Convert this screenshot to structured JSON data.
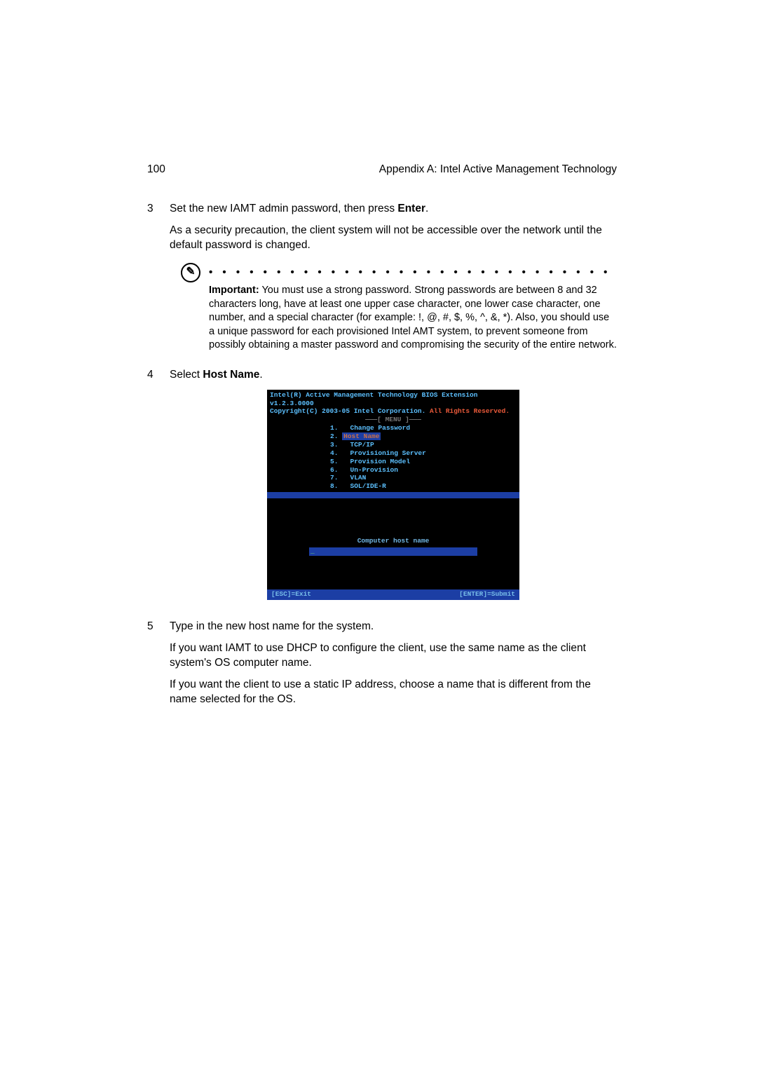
{
  "header": {
    "page_number": "100",
    "appendix_title": "Appendix A: Intel Active Management Technology"
  },
  "step3": {
    "num": "3",
    "line1a": "Set the new IAMT admin password, then press ",
    "line1b": "Enter",
    "line1c": ".",
    "para2": "As a security precaution, the client system will not be accessible over the network until the default password is changed."
  },
  "important": {
    "icon_glyph": "✎",
    "dots": "• • • • • • • • • • • • • • • • • • • • • • • • • • • • • • • • • • • • • • • • • • •",
    "label": "Important:",
    "body": "  You must use a strong password.  Strong passwords are between 8 and 32 characters long, have at least one upper case character, one lower case character, one number, and a special character (for example: !, @, #, $, %, ^, &, *). Also, you should use a unique password for each provisioned Intel AMT system, to prevent someone from possibly obtaining a master password and compromising the security of the entire network."
  },
  "step4": {
    "num": "4",
    "line1a": "Select ",
    "line1b": "Host Name",
    "line1c": "."
  },
  "bios": {
    "title_line1a": "Intel(R) Active Management Technology BIOS Extension v1.2.3.0000",
    "title_line2a": "Copyright(C) 2003-05 Intel Corporation.  ",
    "title_line2b": "All Rights Reserved.",
    "menu_label": "———[ MENU ]———",
    "items": [
      "1.   Change Password",
      "2.   Host Name",
      "3.   TCP/IP",
      "4.   Provisioning Server",
      "5.   Provision Model",
      "6.   Un-Provision",
      "7.   VLAN",
      "8.   SOL/IDE-R"
    ],
    "selected_index": 1,
    "prompt": "Computer host name",
    "input_cursor": "_",
    "foot_left": "[ESC]=Exit",
    "foot_right": "[ENTER]=Submit"
  },
  "step5": {
    "num": "5",
    "para1": "Type in the new host name for the system.",
    "para2": "If you want IAMT to use DHCP to configure the client, use the same name as the client system's OS computer name.",
    "para3": "If you want the client to use a static IP address, choose a name that is different from the name selected for the OS."
  }
}
